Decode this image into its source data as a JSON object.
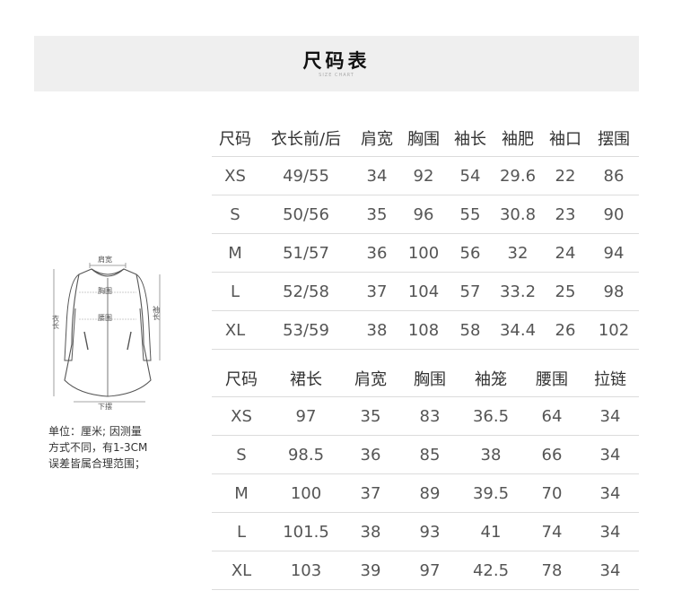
{
  "banner": {
    "title": "尺码表",
    "subtitle": "SIZE CHART"
  },
  "figure": {
    "top_label": "肩宽",
    "chest_label": "胸围",
    "waist_label": "腰围",
    "length_label": "衣长",
    "sleeve_label": "袖长",
    "hem_label": "下摆"
  },
  "note": {
    "lines": [
      "单位：厘米; 因测量",
      "方式不同，有1-3CM",
      "误差皆属合理范围；"
    ]
  },
  "table1": {
    "headers": [
      "尺码",
      "衣长前/后",
      "肩宽",
      "胸围",
      "袖长",
      "袖肥",
      "袖口",
      "摆围"
    ],
    "rows": [
      [
        "XS",
        "49/55",
        "34",
        "92",
        "54",
        "29.6",
        "22",
        "86"
      ],
      [
        "S",
        "50/56",
        "35",
        "96",
        "55",
        "30.8",
        "23",
        "90"
      ],
      [
        "M",
        "51/57",
        "36",
        "100",
        "56",
        "32",
        "24",
        "94"
      ],
      [
        "L",
        "52/58",
        "37",
        "104",
        "57",
        "33.2",
        "25",
        "98"
      ],
      [
        "XL",
        "53/59",
        "38",
        "108",
        "58",
        "34.4",
        "26",
        "102"
      ]
    ]
  },
  "table2": {
    "headers": [
      "尺码",
      "裙长",
      "肩宽",
      "胸围",
      "袖笼",
      "腰围",
      "拉链"
    ],
    "rows": [
      [
        "XS",
        "97",
        "35",
        "83",
        "36.5",
        "64",
        "34"
      ],
      [
        "S",
        "98.5",
        "36",
        "85",
        "38",
        "66",
        "34"
      ],
      [
        "M",
        "100",
        "37",
        "89",
        "39.5",
        "70",
        "34"
      ],
      [
        "L",
        "101.5",
        "38",
        "93",
        "41",
        "74",
        "34"
      ],
      [
        "XL",
        "103",
        "39",
        "97",
        "42.5",
        "78",
        "34"
      ]
    ]
  }
}
